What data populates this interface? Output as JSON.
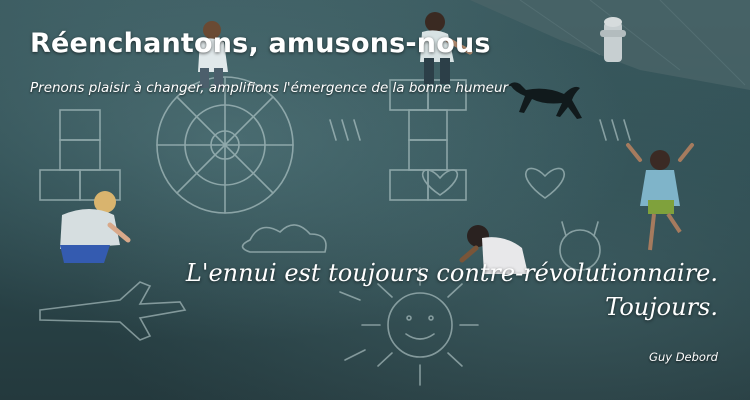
{
  "banner": {
    "title": "Réenchantons, amusons-nous",
    "subtitle": "Prenons plaisir à changer, amplifions l'émergence de la bonne humeur",
    "quote_line1": "L'ennui est toujours contre-révolutionnaire.",
    "quote_line2": "Toujours.",
    "author": "Guy Debord"
  },
  "colors": {
    "text": "#ffffff",
    "background": "#2f4a4e",
    "chalk": "#c9dcdc"
  }
}
